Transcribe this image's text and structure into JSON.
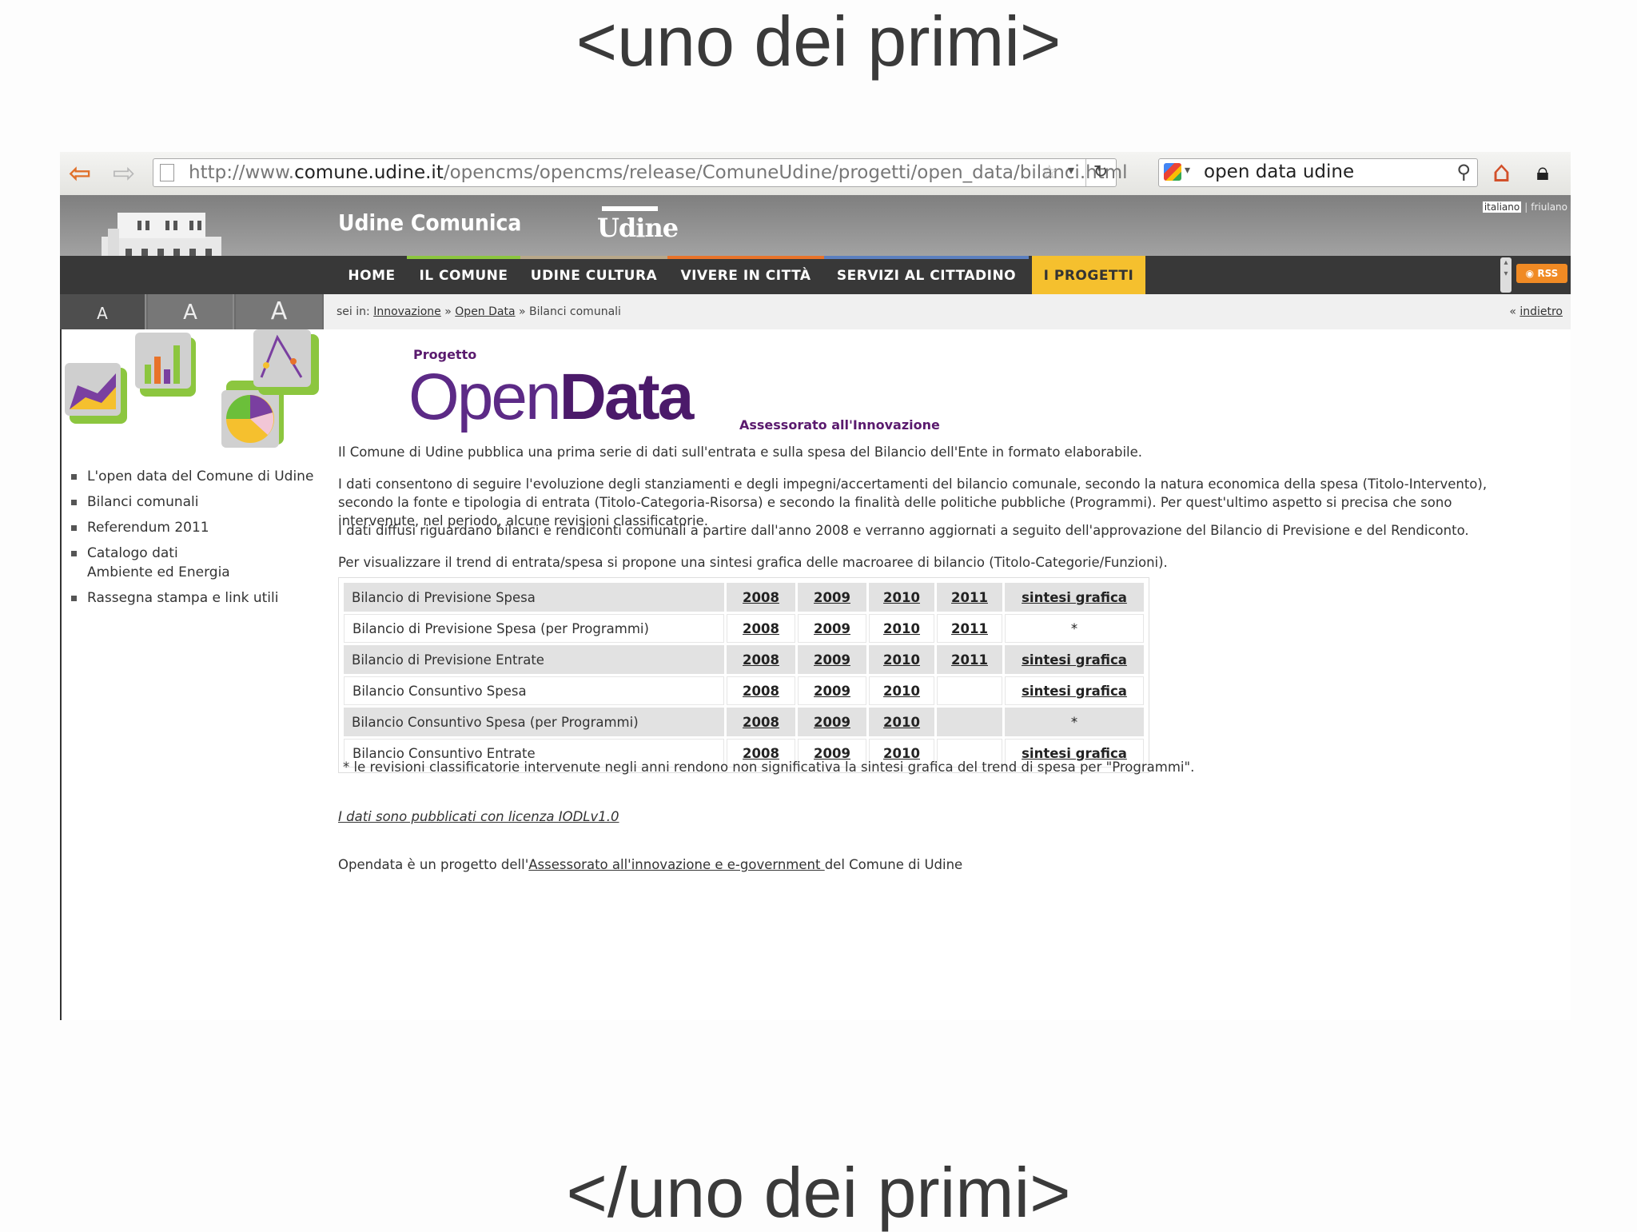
{
  "slide": {
    "top_title": "<uno dei primi>",
    "bottom_title": "</uno dei primi>"
  },
  "browser": {
    "url_prefix": "http://www.",
    "url_domain": "comune.udine.it",
    "url_path": "/opencms/opencms/release/ComuneUdine/progetti/open_data/bilanci.html",
    "search_value": "open data udine",
    "icons": [
      "back-arrow-icon",
      "forward-arrow-icon",
      "page-icon",
      "bookmark-star-icon",
      "dropdown-icon",
      "reload-icon",
      "google-icon",
      "magnifier-icon",
      "home-icon",
      "lock-icon"
    ]
  },
  "header": {
    "site_name": "Udine Comunica",
    "city_logo_text": "Udine",
    "lang_italiano": "italiano",
    "lang_sep": "|",
    "lang_friulano": "friulano",
    "rss": "RSS"
  },
  "nav": {
    "home": "HOME",
    "comune": "IL COMUNE",
    "cultura": "UDINE CULTURA",
    "vivere": "VIVERE IN CITTÀ",
    "servizi": "SERVIZI AL CITTADINO",
    "progetti": "I PROGETTI",
    "colors": {
      "comune": "#8cc63f",
      "cultura": "#b8a88a",
      "vivere": "#e8732a",
      "servizi": "#5b7fbf",
      "progetti": "#f5c02e"
    }
  },
  "font_controls": {
    "small": "A",
    "medium": "A",
    "large": "A"
  },
  "breadcrumb": {
    "prefix": "sei in:",
    "level1": "Innovazione",
    "sep": "»",
    "level2": "Open Data",
    "current": "Bilanci comunali",
    "back_prefix": "«",
    "back": "indietro"
  },
  "sidebar": {
    "items": [
      {
        "label": "L'open data del Comune di Udine"
      },
      {
        "label": "Bilanci comunali"
      },
      {
        "label": "Referendum 2011"
      },
      {
        "label": "Catalogo dati Ambiente ed Energia"
      },
      {
        "label": "Rassegna stampa e link utili"
      }
    ]
  },
  "main": {
    "progetto": "Progetto",
    "logo_open": "Open",
    "logo_data": "Data",
    "assessorato": "Assessorato all'Innovazione",
    "p1": "Il Comune di Udine pubblica una prima serie di dati sull'entrata e sulla spesa del Bilancio dell'Ente in formato elaborabile.",
    "p2": "I dati consentono di seguire l'evoluzione degli stanziamenti e degli impegni/accertamenti del bilancio comunale, secondo la natura economica della spesa (Titolo-Intervento), secondo la fonte e tipologia di entrata (Titolo-Categoria-Risorsa) e secondo la finalità delle politiche pubbliche (Programmi). Per quest'ultimo aspetto si precisa che sono intervenute, nel periodo, alcune revisioni classificatorie.",
    "p3": "I dati diffusi riguardano bilanci e rendiconti comunali a partire dall'anno 2008 e verranno aggiornati a seguito dell'approvazione del Bilancio di Previsione e del Rendiconto.",
    "p4": "Per visualizzare il trend di entrata/spesa si propone una sintesi grafica delle macroaree di bilancio (Titolo-Categorie/Funzioni).",
    "table": [
      {
        "label": "Bilancio di Previsione Spesa",
        "y2008": "2008",
        "y2009": "2009",
        "y2010": "2010",
        "y2011": "2011",
        "extra": "sintesi grafica"
      },
      {
        "label": "Bilancio di Previsione Spesa (per Programmi)",
        "y2008": "2008",
        "y2009": "2009",
        "y2010": "2010",
        "y2011": "2011",
        "extra": "*"
      },
      {
        "label": "Bilancio di Previsione Entrate",
        "y2008": "2008",
        "y2009": "2009",
        "y2010": "2010",
        "y2011": "2011",
        "extra": "sintesi grafica"
      },
      {
        "label": "Bilancio Consuntivo Spesa",
        "y2008": "2008",
        "y2009": "2009",
        "y2010": "2010",
        "y2011": "",
        "extra": "sintesi grafica"
      },
      {
        "label": "Bilancio Consuntivo Spesa (per Programmi)",
        "y2008": "2008",
        "y2009": "2009",
        "y2010": "2010",
        "y2011": "",
        "extra": "*"
      },
      {
        "label": "Bilancio Consuntivo Entrate",
        "y2008": "2008",
        "y2009": "2009",
        "y2010": "2010",
        "y2011": "",
        "extra": "sintesi grafica"
      }
    ],
    "footnote": "* le revisioni classificatorie intervenute negli anni rendono non significativa la sintesi grafica del trend di spesa per \"Programmi\".",
    "license": "I dati sono pubblicati con licenza IODLv1.0",
    "credits_prefix": "Opendata è un progetto dell'",
    "credits_link": "Assessorato all'innovazione e e-government ",
    "credits_suffix": "del Comune di Udine"
  }
}
